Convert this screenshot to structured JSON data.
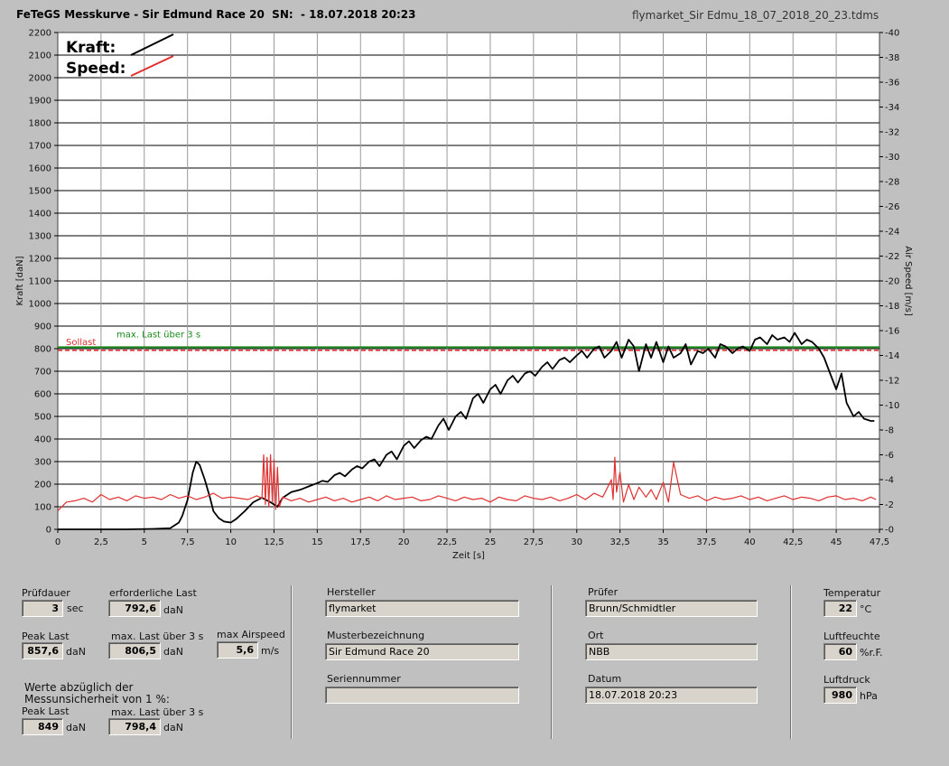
{
  "header": {
    "title": "FeTeGS Messkurve - Sir Edmund Race 20  SN:  - 18.07.2018 20:23",
    "file": "flymarket_Sir Edmu_18_07_2018_20_23.tdms"
  },
  "chart_data": {
    "type": "line",
    "xlabel": "Zeit [s]",
    "ylabel": "Kraft [daN]",
    "y2label": "Air Speed [m/s]",
    "xlim": [
      0,
      47.5
    ],
    "ylim": [
      0,
      2200
    ],
    "y2lim": [
      0,
      40
    ],
    "x_ticks": [
      "0",
      "2,5",
      "5",
      "7,5",
      "10",
      "12,5",
      "15",
      "17,5",
      "20",
      "22,5",
      "25",
      "27,5",
      "30",
      "32,5",
      "35",
      "37,5",
      "40",
      "42,5",
      "45",
      "47,5"
    ],
    "y_ticks": [
      "0",
      "100",
      "200",
      "300",
      "400",
      "500",
      "600",
      "700",
      "800",
      "900",
      "1000",
      "1100",
      "1200",
      "1300",
      "1400",
      "1500",
      "1600",
      "1700",
      "1800",
      "1900",
      "2000",
      "2100",
      "2200"
    ],
    "y2_ticks": [
      "0",
      "2",
      "4",
      "6",
      "8",
      "10",
      "12",
      "14",
      "16",
      "18",
      "20",
      "22",
      "24",
      "26",
      "28",
      "30",
      "32",
      "34",
      "36",
      "38",
      "40"
    ],
    "grid": true,
    "legend": [
      {
        "name": "Kraft:",
        "color": "#000000"
      },
      {
        "name": "Speed:",
        "color": "#e03030"
      }
    ],
    "reference_lines": [
      {
        "name": "Sollast",
        "value": 792.6,
        "color": "#e03030",
        "style": "dashed"
      },
      {
        "name": "max. Last über  3 s",
        "value": 806.5,
        "color": "#1a8a1a",
        "style": "solid"
      }
    ],
    "series": [
      {
        "name": "Kraft:",
        "axis": "left",
        "color": "#000000",
        "x": [
          0,
          2,
          4,
          5.5,
          6.5,
          7,
          7.2,
          7.5,
          7.8,
          8,
          8.2,
          8.5,
          8.8,
          9,
          9.3,
          9.6,
          10,
          10.3,
          10.8,
          11.3,
          11.8,
          12.3,
          12.7,
          13,
          13.5,
          14,
          14.5,
          15,
          15.3,
          15.6,
          16,
          16.3,
          16.6,
          17,
          17.3,
          17.6,
          18,
          18.3,
          18.6,
          19,
          19.3,
          19.6,
          20,
          20.3,
          20.6,
          21,
          21.3,
          21.6,
          22,
          22.3,
          22.6,
          23,
          23.3,
          23.6,
          24,
          24.3,
          24.6,
          25,
          25.3,
          25.6,
          26,
          26.3,
          26.6,
          27,
          27.3,
          27.6,
          28,
          28.3,
          28.6,
          29,
          29.3,
          29.6,
          30,
          30.3,
          30.6,
          31,
          31.3,
          31.6,
          32,
          32.3,
          32.6,
          33,
          33.3,
          33.6,
          34,
          34.3,
          34.6,
          35,
          35.3,
          35.6,
          36,
          36.3,
          36.6,
          37,
          37.3,
          37.6,
          38,
          38.3,
          38.6,
          39,
          39.3,
          39.6,
          40,
          40.3,
          40.6,
          41,
          41.3,
          41.6,
          42,
          42.3,
          42.6,
          43,
          43.3,
          43.6,
          44,
          44.3,
          44.6,
          45,
          45.3,
          45.6,
          46,
          46.3,
          46.6,
          47,
          47.2
        ],
        "y": [
          0,
          0,
          0,
          2,
          5,
          30,
          60,
          130,
          250,
          300,
          285,
          220,
          140,
          80,
          50,
          35,
          30,
          45,
          80,
          120,
          140,
          120,
          100,
          140,
          165,
          175,
          190,
          205,
          215,
          210,
          240,
          250,
          235,
          265,
          280,
          270,
          300,
          310,
          280,
          330,
          345,
          310,
          370,
          390,
          360,
          395,
          410,
          400,
          460,
          490,
          440,
          500,
          520,
          490,
          580,
          600,
          560,
          620,
          640,
          600,
          660,
          680,
          650,
          690,
          700,
          680,
          720,
          740,
          710,
          750,
          760,
          740,
          770,
          790,
          760,
          800,
          810,
          760,
          790,
          830,
          760,
          840,
          810,
          700,
          820,
          760,
          830,
          740,
          810,
          760,
          780,
          820,
          730,
          790,
          780,
          800,
          760,
          820,
          810,
          780,
          800,
          810,
          790,
          840,
          850,
          820,
          860,
          840,
          850,
          830,
          870,
          820,
          840,
          830,
          800,
          760,
          700,
          620,
          690,
          560,
          500,
          520,
          490,
          480,
          480
        ]
      },
      {
        "name": "Speed:",
        "axis": "right",
        "color": "#e03030",
        "x": [
          0,
          0.5,
          1,
          1.5,
          2,
          2.5,
          3,
          3.5,
          4,
          4.5,
          5,
          5.5,
          6,
          6.5,
          7,
          7.5,
          8,
          8.5,
          9,
          9.5,
          10,
          10.5,
          11,
          11.5,
          11.8,
          11.9,
          12,
          12.1,
          12.2,
          12.3,
          12.4,
          12.5,
          12.6,
          12.7,
          12.8,
          13,
          13.5,
          14,
          14.5,
          15,
          15.5,
          16,
          16.5,
          17,
          17.5,
          18,
          18.5,
          19,
          19.5,
          20,
          20.5,
          21,
          21.5,
          22,
          22.5,
          23,
          23.5,
          24,
          24.5,
          25,
          25.5,
          26,
          26.5,
          27,
          27.5,
          28,
          28.5,
          29,
          29.5,
          30,
          30.5,
          31,
          31.5,
          32,
          32.1,
          32.2,
          32.3,
          32.5,
          32.7,
          33,
          33.3,
          33.6,
          34,
          34.3,
          34.6,
          35,
          35.3,
          35.6,
          36,
          36.5,
          37,
          37.5,
          38,
          38.5,
          39,
          39.5,
          40,
          40.5,
          41,
          41.5,
          42,
          42.5,
          43,
          43.5,
          44,
          44.5,
          45,
          45.5,
          46,
          46.5,
          47,
          47.3
        ],
        "y": [
          1.5,
          2.2,
          2.3,
          2.5,
          2.2,
          2.8,
          2.4,
          2.6,
          2.3,
          2.7,
          2.5,
          2.6,
          2.4,
          2.8,
          2.5,
          2.7,
          2.4,
          2.6,
          2.9,
          2.5,
          2.6,
          2.5,
          2.4,
          2.7,
          2.5,
          6,
          2,
          5.8,
          1.8,
          6,
          2.2,
          5.6,
          1.6,
          5,
          1.8,
          2.6,
          2.3,
          2.5,
          2.2,
          2.4,
          2.6,
          2.3,
          2.5,
          2.2,
          2.4,
          2.6,
          2.3,
          2.7,
          2.4,
          2.5,
          2.6,
          2.3,
          2.4,
          2.7,
          2.5,
          2.3,
          2.6,
          2.4,
          2.5,
          2.2,
          2.6,
          2.4,
          2.3,
          2.7,
          2.5,
          2.4,
          2.6,
          2.3,
          2.5,
          2.8,
          2.4,
          2.9,
          2.6,
          4,
          2.4,
          5.8,
          3,
          4.6,
          2.2,
          3.6,
          2.4,
          3.4,
          2.6,
          3.2,
          2.4,
          3.8,
          2.2,
          5.4,
          2.8,
          2.5,
          2.7,
          2.3,
          2.6,
          2.4,
          2.5,
          2.7,
          2.4,
          2.6,
          2.3,
          2.5,
          2.7,
          2.4,
          2.6,
          2.5,
          2.3,
          2.6,
          2.7,
          2.4,
          2.5,
          2.3,
          2.6,
          2.4
        ]
      }
    ]
  },
  "panel": {
    "pruefdauer_label": "Prüfdauer",
    "pruefdauer_value": "3",
    "pruefdauer_unit": "sec",
    "erf_last_label": "erforderliche Last",
    "erf_last_value": "792,6",
    "erf_last_unit": "daN",
    "peak_last_label": "Peak Last",
    "peak_last_value": "857,6",
    "peak_last_unit": "daN",
    "max_last_label": "max. Last über  3 s",
    "max_last_value": "806,5",
    "max_last_unit": "daN",
    "max_airspeed_label": "max Airspeed",
    "max_airspeed_value": "5,6",
    "max_airspeed_unit": "m/s",
    "note_line1": "Werte abzüglich der",
    "note_line2": "Messunsicherheit von 1  %:",
    "peak_last2_label": "Peak Last",
    "peak_last2_value": "849",
    "peak_last2_unit": "daN",
    "max_last2_label": "max. Last über  3 s",
    "max_last2_value": "798,4",
    "max_last2_unit": "daN",
    "hersteller_label": "Hersteller",
    "hersteller_value": "flymarket",
    "muster_label": "Musterbezeichnung",
    "muster_value": "Sir Edmund Race 20",
    "serien_label": "Seriennummer",
    "serien_value": "",
    "pruefer_label": "Prüfer",
    "pruefer_value": "Brunn/Schmidtler",
    "ort_label": "Ort",
    "ort_value": "NBB",
    "datum_label": "Datum",
    "datum_value": "18.07.2018 20:23",
    "temp_label": "Temperatur",
    "temp_value": "22",
    "temp_unit": "°C",
    "feuchte_label": "Luftfeuchte",
    "feuchte_value": "60",
    "feuchte_unit": "%r.F.",
    "druck_label": "Luftdruck",
    "druck_value": "980",
    "druck_unit": "hPa"
  }
}
